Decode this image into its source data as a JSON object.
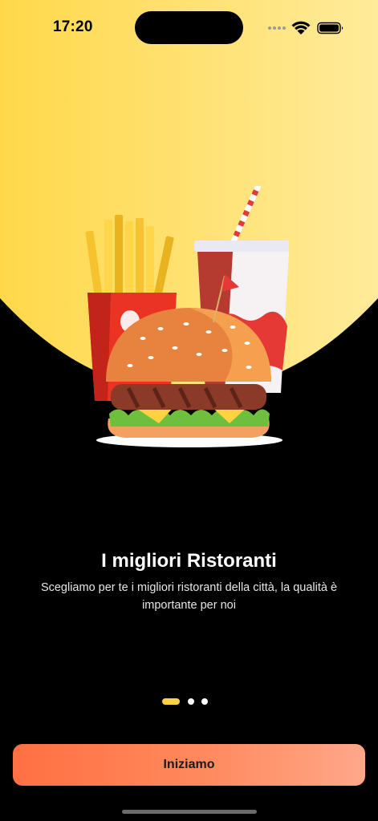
{
  "status_bar": {
    "time": "17:20"
  },
  "onboarding": {
    "title": "I migliori Ristoranti",
    "subtitle": "Scegliamo per te i migliori ristoranti della città, la qualità è importante per noi",
    "page_indicator": {
      "total_pages": 3,
      "current_page": 1
    }
  },
  "start_button": {
    "label": "Iniziamo"
  },
  "colors": {
    "background": "#000000",
    "hero_yellow": "#ffd84a",
    "accent": "#ffd23f",
    "button_gradient_start": "#ff7043",
    "button_gradient_end": "#ffa78a"
  },
  "illustration": {
    "icons": [
      "french-fries-icon",
      "soda-cup-icon",
      "burger-icon"
    ]
  }
}
